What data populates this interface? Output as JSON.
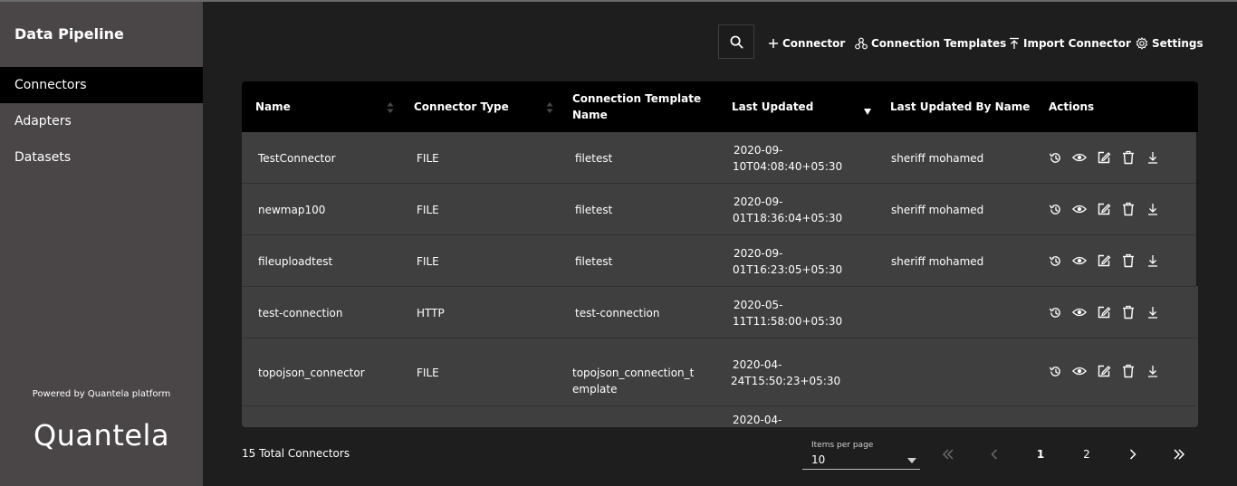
{
  "sidebar": {
    "title": "Data Pipeline",
    "items": [
      {
        "label": "Connectors",
        "active": true
      },
      {
        "label": "Adapters",
        "active": false
      },
      {
        "label": "Datasets",
        "active": false
      }
    ],
    "powered_by": "Powered by Quantela platform",
    "logo": "Quantela"
  },
  "toolbar": {
    "search_icon": "search-icon",
    "add_connector": "Connector",
    "connection_templates": "Connection Templates",
    "import_connector": "Import Connector",
    "settings": "Settings"
  },
  "table": {
    "headers": {
      "name": "Name",
      "connector_type": "Connector Type",
      "template_line1": "Connection Template",
      "template_line2": "Name",
      "last_updated": "Last Updated",
      "last_updated_by": "Last Updated By Name",
      "actions": "Actions"
    },
    "rows": [
      {
        "name": "TestConnector",
        "type": "FILE",
        "template": "filetest",
        "updated_l1": "2020-09-",
        "updated_l2": "10T04:08:40+05:30",
        "by": "sheriff mohamed"
      },
      {
        "name": "newmap100",
        "type": "FILE",
        "template": "filetest",
        "updated_l1": "2020-09-",
        "updated_l2": "01T18:36:04+05:30",
        "by": "sheriff mohamed"
      },
      {
        "name": "fileuploadtest",
        "type": "FILE",
        "template": "filetest",
        "updated_l1": "2020-09-",
        "updated_l2": "01T16:23:05+05:30",
        "by": "sheriff mohamed"
      },
      {
        "name": "test-connection",
        "type": "HTTP",
        "template": "test-connection",
        "updated_l1": "2020-05-",
        "updated_l2": "11T11:58:00+05:30",
        "by": ""
      },
      {
        "name": "topojson_connector",
        "type": "FILE",
        "template_l1": "topojson_connection_t",
        "template_l2": "emplate",
        "updated_l1": "2020-04-",
        "updated_l2": "24T15:50:23+05:30",
        "by": ""
      },
      {
        "name": "",
        "type": "",
        "template": "",
        "updated_l1": "2020-04-",
        "updated_l2": "",
        "by": ""
      }
    ]
  },
  "footer": {
    "total": "15 Total Connectors",
    "items_per_page_label": "Items per page",
    "items_per_page_value": "10",
    "pages": [
      "1",
      "2"
    ],
    "current_page": "1"
  },
  "colors": {
    "background": "#1e1e1e",
    "sidebar": "#4a4648",
    "active_nav": "#000000",
    "table_header": "#000000",
    "row": "#3f3f3f"
  }
}
